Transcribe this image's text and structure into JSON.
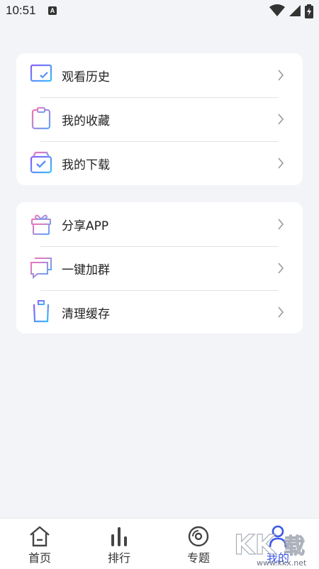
{
  "status_bar": {
    "time": "10:51",
    "notification_letter": "A"
  },
  "menu_group_1": [
    {
      "label": "观看历史",
      "icon": "history-tv-icon"
    },
    {
      "label": "我的收藏",
      "icon": "favorites-clipboard-icon"
    },
    {
      "label": "我的下载",
      "icon": "download-box-icon"
    }
  ],
  "menu_group_2": [
    {
      "label": "分享APP",
      "icon": "gift-icon"
    },
    {
      "label": "一键加群",
      "icon": "chat-group-icon"
    },
    {
      "label": "清理缓存",
      "icon": "trash-icon"
    }
  ],
  "tabbar": {
    "tabs": [
      {
        "label": "首页",
        "icon": "home-icon"
      },
      {
        "label": "排行",
        "icon": "ranking-bars-icon"
      },
      {
        "label": "专题",
        "icon": "topic-disc-icon"
      },
      {
        "label": "我的",
        "icon": "user-icon",
        "active": true
      }
    ]
  },
  "watermark": {
    "brand": "KK下载",
    "url": "www.kkx.net"
  },
  "colors": {
    "accent": "#3b57e6",
    "background": "#f2f4f8",
    "icon_gradient_start": "#8b5cf6",
    "icon_gradient_end": "#38bdf8"
  }
}
